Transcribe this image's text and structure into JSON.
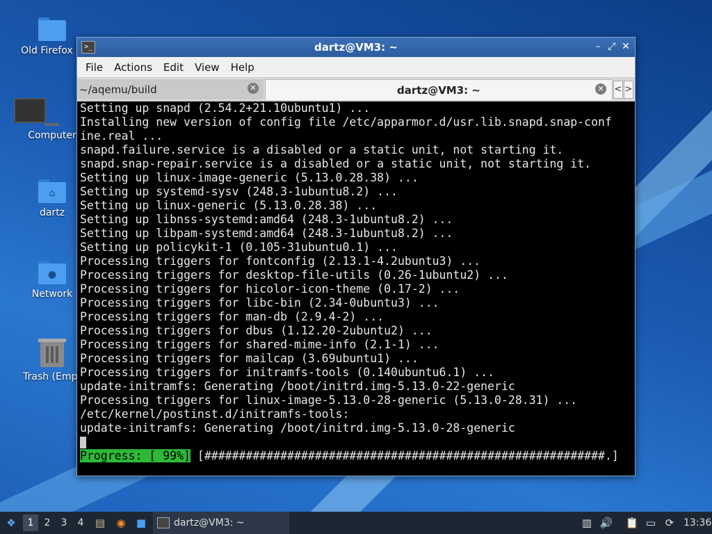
{
  "desktop": {
    "icons": [
      {
        "label": "Old Firefox D"
      },
      {
        "label": "Computer"
      },
      {
        "label": "dartz"
      },
      {
        "label": "Network"
      },
      {
        "label": "Trash (Empt"
      }
    ]
  },
  "window": {
    "title": "dartz@VM3: ~",
    "icon": "terminal-icon",
    "controls": [
      "minimize",
      "maximize",
      "close"
    ],
    "menu": [
      "File",
      "Actions",
      "Edit",
      "View",
      "Help"
    ],
    "tabs": [
      {
        "label": "~/aqemu/build",
        "active": false
      },
      {
        "label": "dartz@VM3: ~",
        "active": true
      }
    ],
    "scroll_left": "<",
    "scroll_right": ">"
  },
  "terminal": {
    "lines": [
      "Setting up snapd (2.54.2+21.10ubuntu1) ...",
      "Installing new version of config file /etc/apparmor.d/usr.lib.snapd.snap-conf",
      "ine.real ...",
      "snapd.failure.service is a disabled or a static unit, not starting it.",
      "snapd.snap-repair.service is a disabled or a static unit, not starting it.",
      "Setting up linux-image-generic (5.13.0.28.38) ...",
      "Setting up systemd-sysv (248.3-1ubuntu8.2) ...",
      "Setting up linux-generic (5.13.0.28.38) ...",
      "Setting up libnss-systemd:amd64 (248.3-1ubuntu8.2) ...",
      "Setting up libpam-systemd:amd64 (248.3-1ubuntu8.2) ...",
      "Setting up policykit-1 (0.105-31ubuntu0.1) ...",
      "Processing triggers for fontconfig (2.13.1-4.2ubuntu3) ...",
      "Processing triggers for desktop-file-utils (0.26-1ubuntu2) ...",
      "Processing triggers for hicolor-icon-theme (0.17-2) ...",
      "Processing triggers for libc-bin (2.34-0ubuntu3) ...",
      "Processing triggers for man-db (2.9.4-2) ...",
      "Processing triggers for dbus (1.12.20-2ubuntu2) ...",
      "Processing triggers for shared-mime-info (2.1-1) ...",
      "Processing triggers for mailcap (3.69ubuntu1) ...",
      "Processing triggers for initramfs-tools (0.140ubuntu6.1) ...",
      "update-initramfs: Generating /boot/initrd.img-5.13.0-22-generic",
      "Processing triggers for linux-image-5.13.0-28-generic (5.13.0-28.31) ...",
      "/etc/kernel/postinst.d/initramfs-tools:",
      "update-initramfs: Generating /boot/initrd.img-5.13.0-28-generic"
    ],
    "progress_label": "Progress: [ 99%]",
    "progress_bar": " [##########################################################.]",
    "progress_color": "#2db838"
  },
  "taskbar": {
    "workspaces": [
      "1",
      "2",
      "3",
      "4"
    ],
    "active_workspace": "1",
    "task_label": "dartz@VM3: ~",
    "clock": "13:36",
    "launchers": [
      "start-menu-icon",
      "file-manager-icon",
      "firefox-icon",
      "show-desktop-icon"
    ],
    "tray": [
      "notes-icon",
      "volume-icon",
      "clipboard-icon",
      "network-icon",
      "update-icon"
    ]
  }
}
